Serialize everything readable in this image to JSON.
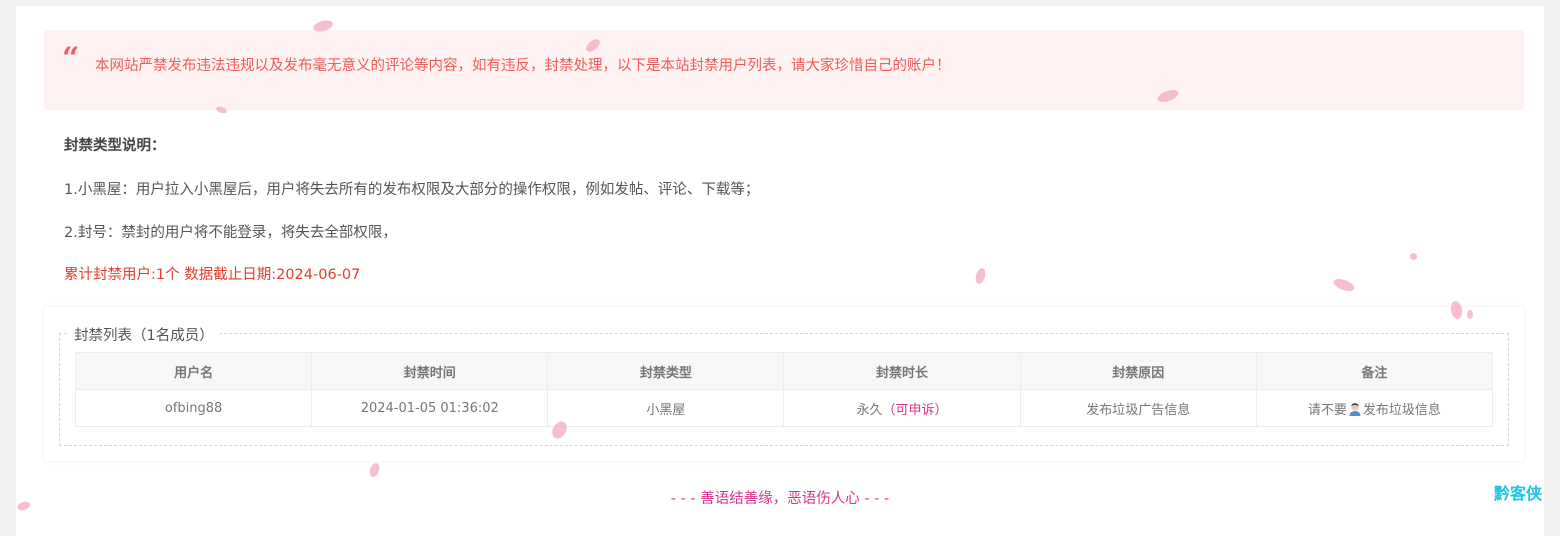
{
  "notice": {
    "text": "本网站严禁发布违法违规以及发布毫无意义的评论等内容，如有违反，封禁处理，以下是本站封禁用户列表，请大家珍惜自己的账户！"
  },
  "info": {
    "heading": "封禁类型说明：",
    "line1": "1.小黑屋：用户拉入小黑屋后，用户将失去所有的发布权限及大部分的操作权限，例如发帖、评论、下载等；",
    "line2": "2.封号：禁封的用户将不能登录，将失去全部权限，",
    "stat": "累计封禁用户:1个 数据截止日期:2024-06-07"
  },
  "ban_list": {
    "title": "封禁列表（1名成员）",
    "columns": [
      "用户名",
      "封禁时间",
      "封禁类型",
      "封禁时长",
      "封禁原因",
      "备注"
    ],
    "rows": [
      {
        "username": "ofbing88",
        "time": "2024-01-05 01:36:02",
        "type": "小黑屋",
        "duration": "永久",
        "appeal": "（可申诉）",
        "reason": "发布垃圾广告信息",
        "remark_before": "请不要",
        "remark_icon": "person-emoji-icon",
        "remark_after": "发布垃圾信息"
      }
    ]
  },
  "footer": {
    "slogan": "- - - 善语结善缘，恶语伤人心 - - -",
    "brand": "黔客侠"
  },
  "colors": {
    "notice_bg": "#fff2f2",
    "notice_text": "#f05a5a",
    "stat_text": "#e63b2e",
    "accent_pink": "#d9338f",
    "brand_cyan": "#1ec3e6",
    "petal": "#f6b3c6"
  }
}
